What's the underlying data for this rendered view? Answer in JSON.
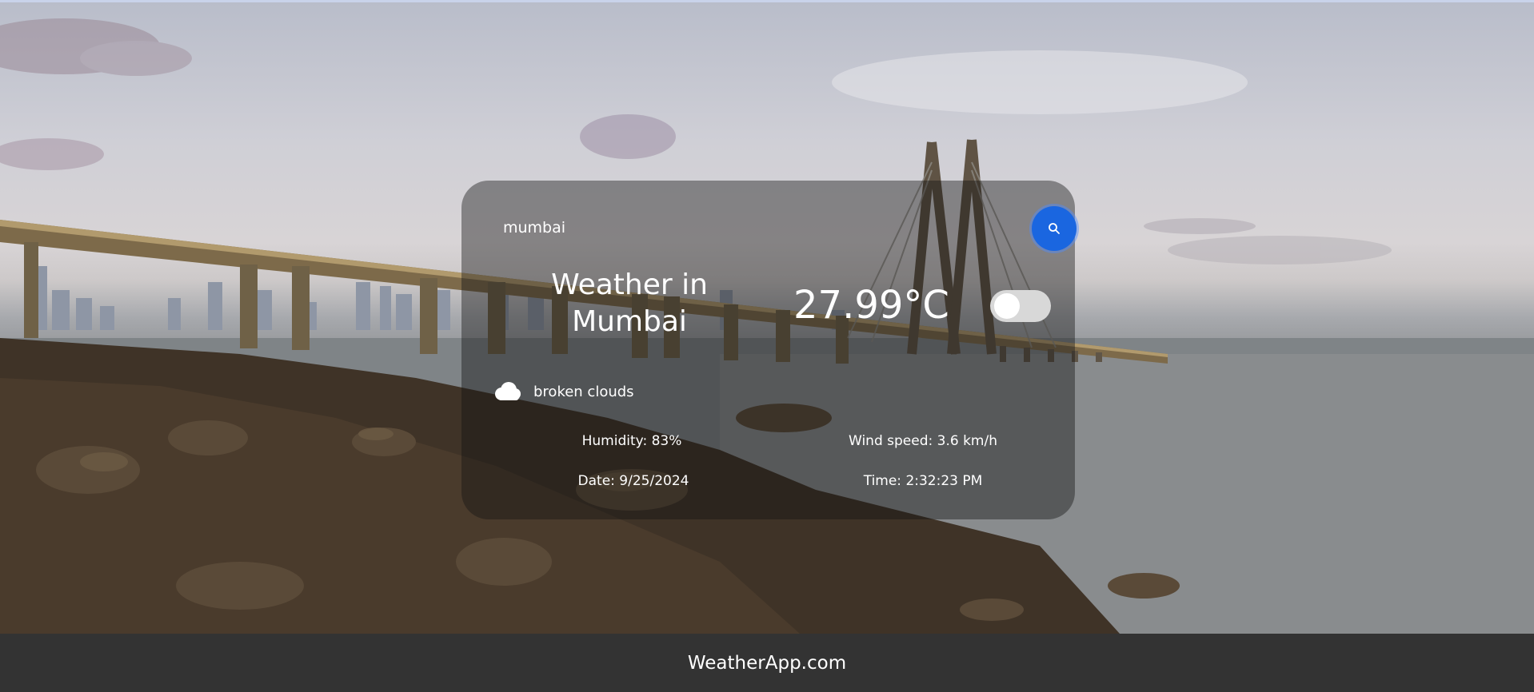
{
  "search": {
    "value": "mumbai",
    "placeholder": "Search"
  },
  "weather": {
    "title": "Weather in Mumbai",
    "temperature": "27.99°C",
    "condition": "broken clouds",
    "condition_icon": "cloud-icon",
    "humidity": "Humidity: 83%",
    "wind": "Wind speed: 3.6 km/h",
    "date": "Date: 9/25/2024",
    "time": "Time: 2:32:23 PM"
  },
  "toggle": {
    "state": "off"
  },
  "footer": {
    "brand": "WeatherApp.com"
  },
  "colors": {
    "search_button": "#1a66e0",
    "footer_bg": "#333333",
    "card_bg": "rgba(20,20,20,0.42)"
  }
}
